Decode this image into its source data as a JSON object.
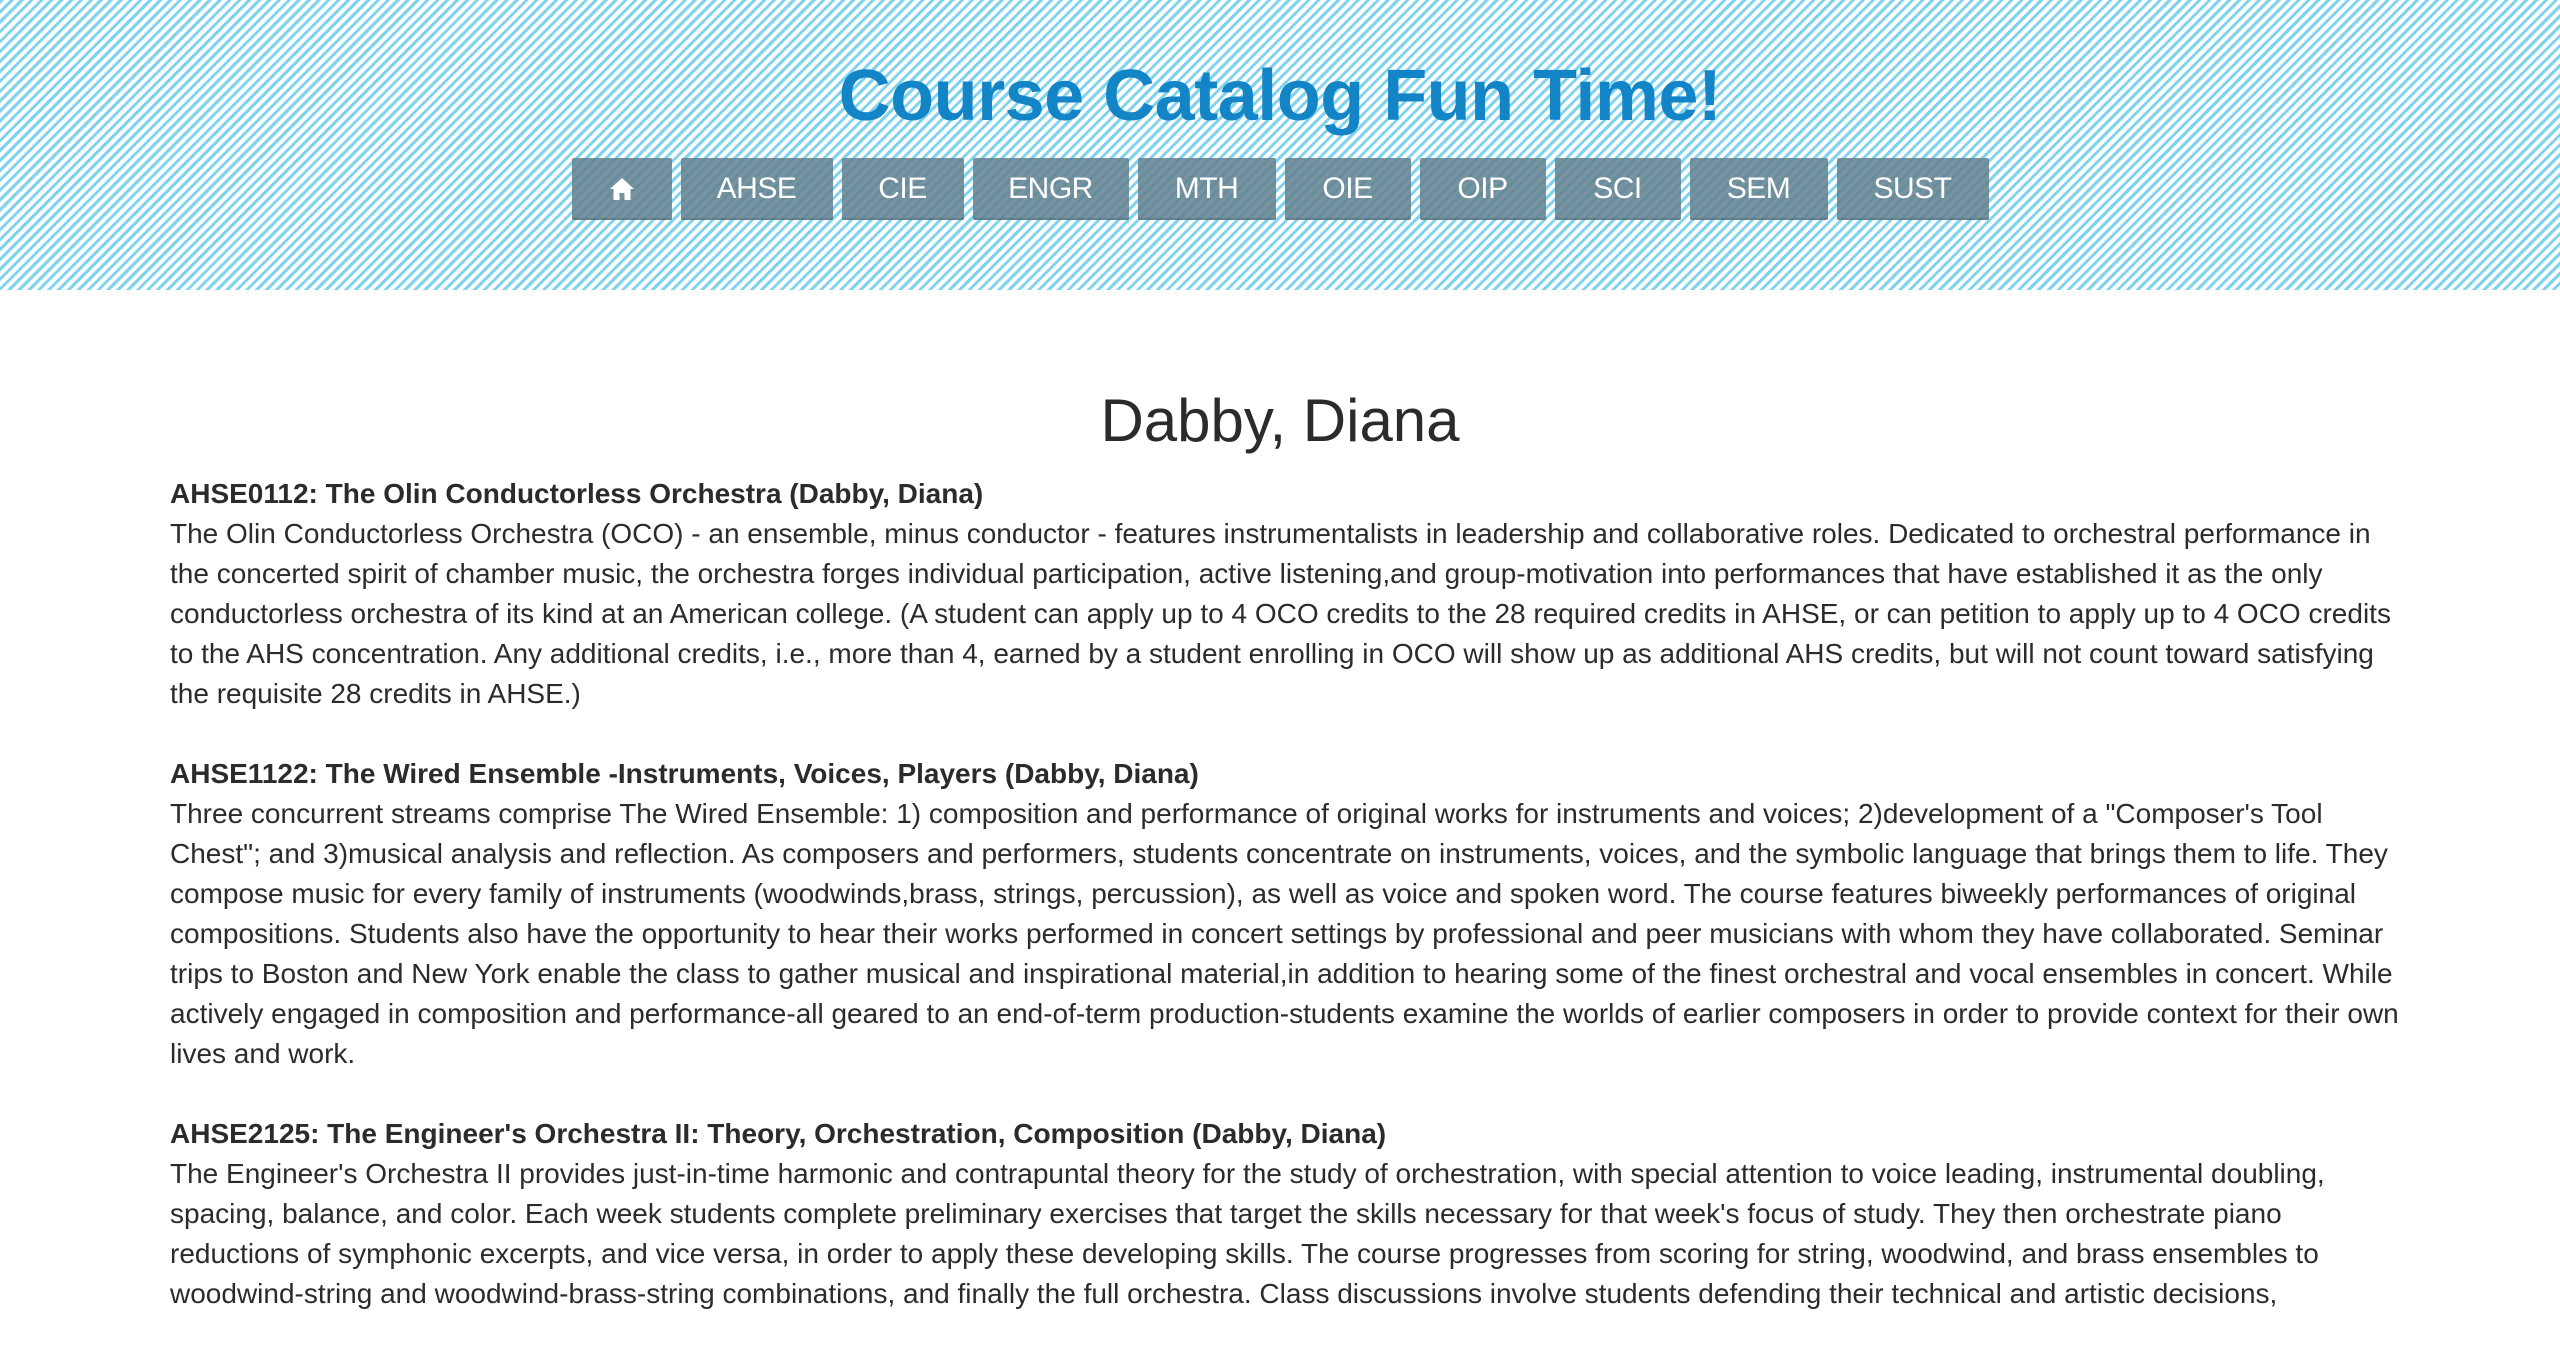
{
  "site": {
    "title": "Course Catalog Fun Time!"
  },
  "nav": {
    "home_icon": "home-icon",
    "items": [
      "AHSE",
      "CIE",
      "ENGR",
      "MTH",
      "OIE",
      "OIP",
      "SCI",
      "SEM",
      "SUST"
    ]
  },
  "page": {
    "heading": "Dabby, Diana"
  },
  "courses": [
    {
      "title": "AHSE0112: The Olin Conductorless Orchestra (Dabby, Diana)",
      "description": "The Olin Conductorless Orchestra (OCO) - an ensemble, minus conductor - features instrumentalists in leadership and collaborative roles. Dedicated to orchestral performance in the concerted spirit of chamber music, the orchestra forges individual participation, active listening,and group-motivation into performances that have established it as the only conductorless orchestra of its kind at an American college. (A student can apply up to 4 OCO credits to the 28 required credits in AHSE, or can petition to apply up to 4 OCO credits to the AHS concentration. Any additional credits, i.e., more than 4, earned by a student enrolling in OCO will show up as additional AHS credits, but will not count toward satisfying the requisite 28 credits in AHSE.)"
    },
    {
      "title": "AHSE1122: The Wired Ensemble -Instruments, Voices, Players (Dabby, Diana)",
      "description": "Three concurrent streams comprise The Wired Ensemble: 1) composition and performance of original works for instruments and voices; 2)development of a \"Composer's Tool Chest\"; and 3)musical analysis and reflection. As composers and performers, students concentrate on instruments, voices, and the symbolic language that brings them to life. They compose music for every family of instruments (woodwinds,brass, strings, percussion), as well as voice and spoken word. The course features biweekly performances of original compositions. Students also have the opportunity to hear their works performed in concert settings by professional and peer musicians with whom they have collaborated. Seminar trips to Boston and New York enable the class to gather musical and inspirational material,in addition to hearing some of the finest orchestral and vocal ensembles in concert. While actively engaged in composition and performance-all geared to an end-of-term production-students examine the worlds of earlier composers in order to provide context for their own lives and work."
    },
    {
      "title": "AHSE2125: The Engineer's Orchestra II: Theory, Orchestration, Composition (Dabby, Diana)",
      "description": "The Engineer's Orchestra II provides just-in-time harmonic and contrapuntal theory for the study of orchestration, with special attention to voice leading, instrumental doubling, spacing, balance, and color. Each week students complete preliminary exercises that target the skills necessary for that week's focus of study. They then orchestrate piano reductions of symphonic excerpts, and vice versa, in order to apply these developing skills. The course progresses from scoring for string, woodwind, and brass ensembles to woodwind-string and woodwind-brass-string combinations, and finally the full orchestra. Class discussions involve students defending their technical and artistic decisions,"
    }
  ],
  "colors": {
    "title": "#1384c6",
    "nav_button": "#6b8c99",
    "stripe": "#7fd3ef"
  }
}
